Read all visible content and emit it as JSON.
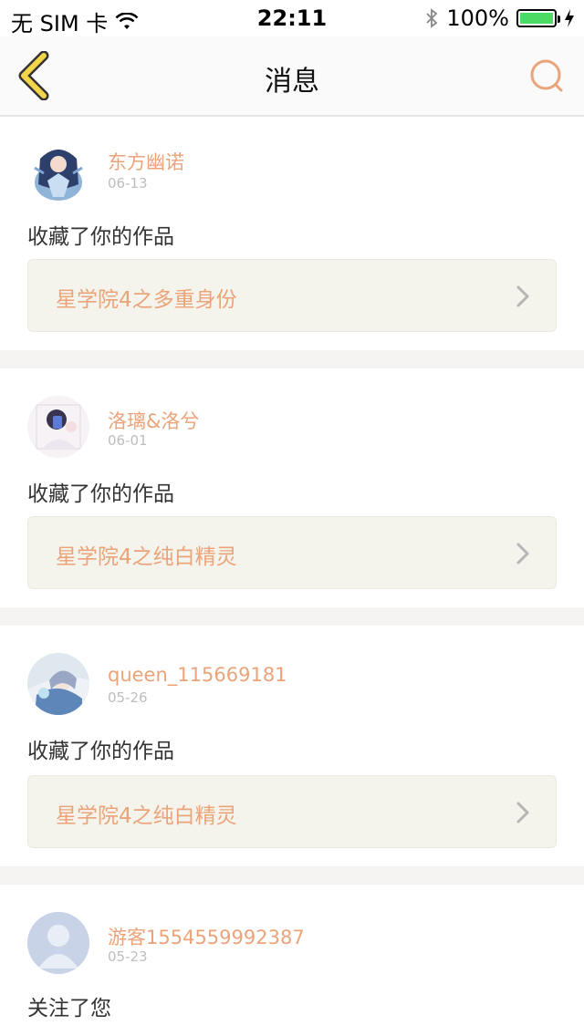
{
  "status_bar": {
    "carrier": "无 SIM 卡",
    "time": "22:11",
    "battery": "100%",
    "icons": [
      "wifi-icon",
      "bluetooth-icon",
      "battery-icon",
      "charging-icon"
    ]
  },
  "nav": {
    "title": "消息",
    "back_icon": "chevron-left-icon",
    "search_icon": "search-icon"
  },
  "colors": {
    "accent": "#eba37a",
    "back_arrow": "#f2d54a",
    "card_link_bg": "#f5f4ec",
    "page_bg": "#f5f4f2"
  },
  "messages": [
    {
      "username": "东方幽诺",
      "date": "06-13",
      "action": "收藏了你的作品",
      "work": "星学院4之多重身份"
    },
    {
      "username": "洛璃&洛兮",
      "date": "06-01",
      "action": "收藏了你的作品",
      "work": "星学院4之纯白精灵"
    },
    {
      "username": "queen_115669181",
      "date": "05-26",
      "action": "收藏了你的作品",
      "work": "星学院4之纯白精灵"
    },
    {
      "username": "游客1554559992387",
      "date": "05-23",
      "action": "关注了您"
    }
  ]
}
